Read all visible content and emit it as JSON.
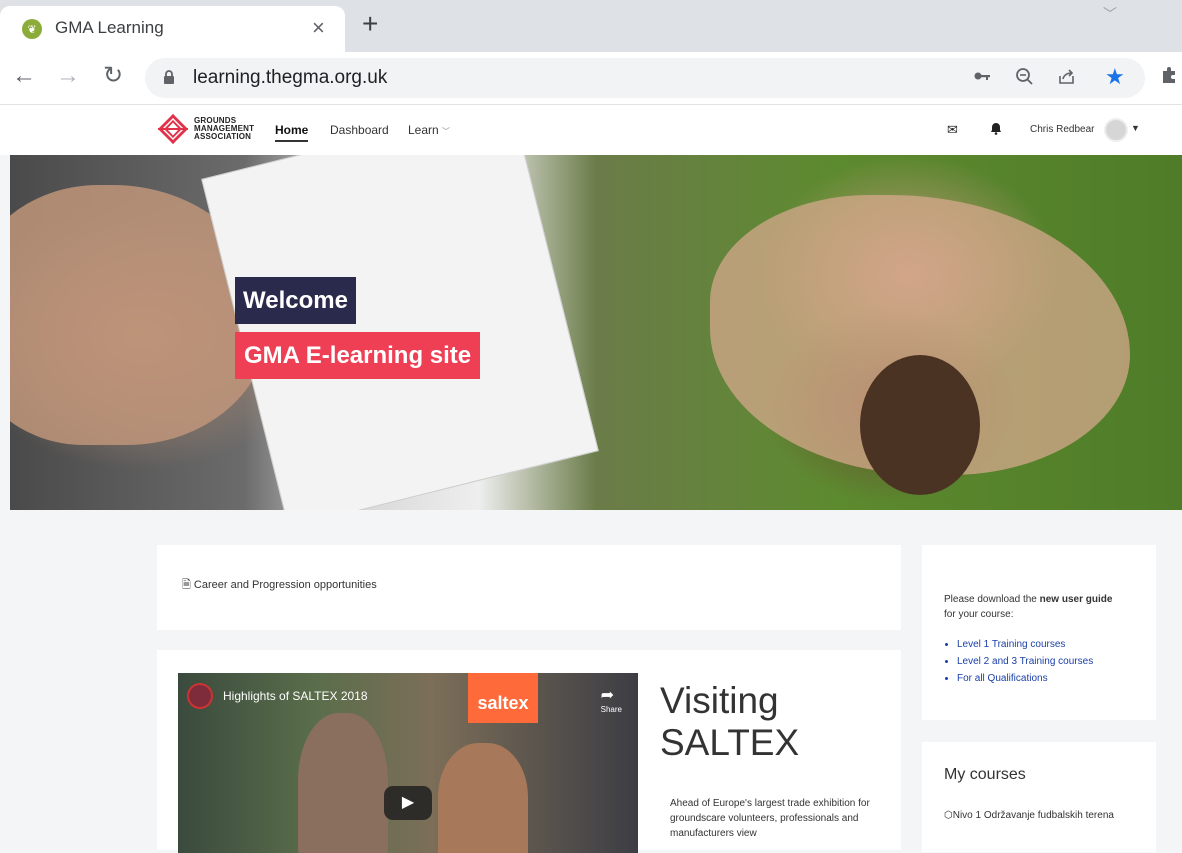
{
  "browser": {
    "tab_title": "GMA Learning",
    "url": "learning.thegma.org.uk"
  },
  "header": {
    "logo_lines": [
      "GROUNDS",
      "MANAGEMENT",
      "ASSOCIATION"
    ],
    "nav": {
      "home": "Home",
      "dashboard": "Dashboard",
      "learn": "Learn"
    },
    "user_name": "Chris Redbear"
  },
  "hero": {
    "welcome": "Welcome",
    "subtitle": "GMA E-learning site"
  },
  "career": {
    "link_text": "Career and Progression opportunities"
  },
  "video": {
    "title": "Highlights of SALTEX 2018",
    "share_label": "Share",
    "sign": "saltex",
    "heading_line1": "Visiting",
    "heading_line2": "SALTEX",
    "description": "Ahead of Europe's largest trade exhibition for groundscare volunteers, professionals and manufacturers view"
  },
  "guide": {
    "intro_before": "Please download the ",
    "intro_bold": "new user guide",
    "intro_after": " for your course:",
    "links": [
      "Level 1 Training courses",
      "Level 2 and 3 Training courses",
      "For all Qualifications"
    ]
  },
  "courses": {
    "title": "My courses",
    "items": [
      "Nivo 1 Održavanje fudbalskih terena"
    ]
  },
  "colors": {
    "welcome_bg": "#2a2a4d",
    "subtitle_bg": "#ef3f54",
    "link": "#1a3fa8"
  }
}
